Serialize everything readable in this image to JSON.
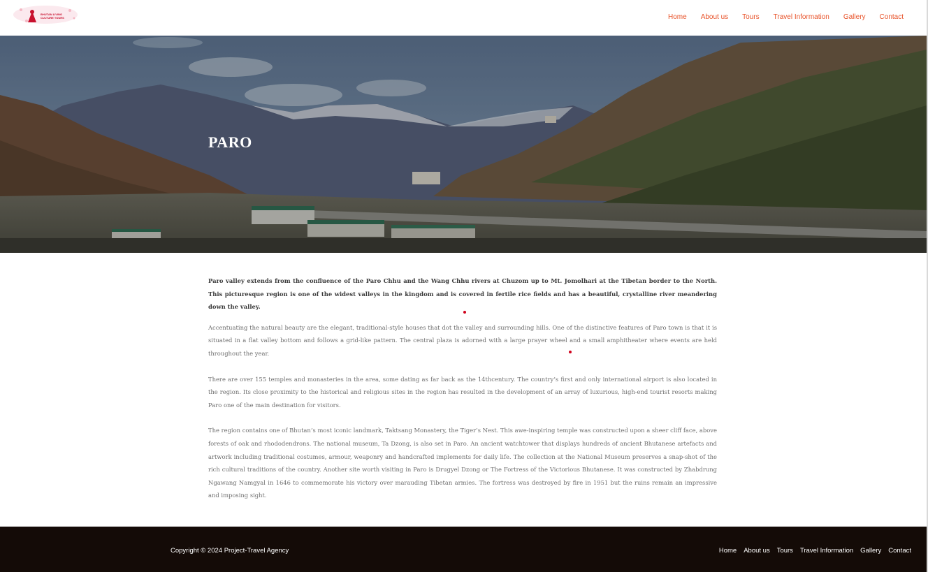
{
  "header": {
    "logo_line1": "BHUTAN LIVING",
    "logo_line2": "CULTURE TOURS",
    "nav": [
      "Home",
      "About us",
      "Tours",
      "Travel Information",
      "Gallery",
      "Contact"
    ]
  },
  "hero": {
    "title": "PARO"
  },
  "content": {
    "paragraphs": [
      "Paro valley extends from the confluence of the Paro Chhu and the Wang Chhu rivers at Chuzom up to Mt. Jomolhari at the Tibetan border to the North. This picturesque region is one of the widest valleys in the kingdom and is covered in fertile rice fields and has a beautiful, crystalline river meandering down the valley.",
      "Accentuating the natural beauty are the elegant, traditional-style houses that dot the valley and surrounding hills. One of the distinctive features of Paro town is that it is situated in a flat valley bottom and follows a grid-like pattern. The central plaza is adorned with a large prayer wheel and a small amphitheater where events are held throughout the year.",
      "There are over 155 temples and monasteries in the area, some dating as far back as the 14thcentury. The country’s first and only international airport is also located in the region. Its close proximity to the historical and religious sites in the region has resulted in the development of an array of luxurious, high-end tourist resorts making Paro one of the main destination for visitors.",
      "The region contains one of Bhutan’s most iconic landmark, Taktsang Monastery, the Tiger’s Nest. This awe-inspiring temple was constructed upon a sheer cliff face, above forests of oak and rhododendrons. The national museum, Ta Dzong, is also set in Paro. An ancient watchtower that displays hundreds of ancient Bhutanese artefacts and artwork including traditional costumes, armour, weaponry and handcrafted implements for daily life. The collection at the National Museum preserves a snap-shot of the rich cultural traditions of the country. Another site worth visiting in Paro is Drugyel Dzong or The Fortress of the Victorious Bhutanese. It was constructed by Zhabdrung Ngawang Namgyal in 1646 to commemorate his victory over marauding Tibetan armies. The fortress was destroyed by fire in 1951 but the ruins remain an impressive and imposing sight."
    ]
  },
  "footer": {
    "copyright": "Copyright © 2024 Project-Travel Agency",
    "nav": [
      "Home",
      "About us",
      "Tours",
      "Travel Information",
      "Gallery",
      "Contact"
    ]
  },
  "colors": {
    "nav_accent": "#e8532a",
    "footer_bg": "#140b07",
    "brand_red": "#c8102e"
  }
}
